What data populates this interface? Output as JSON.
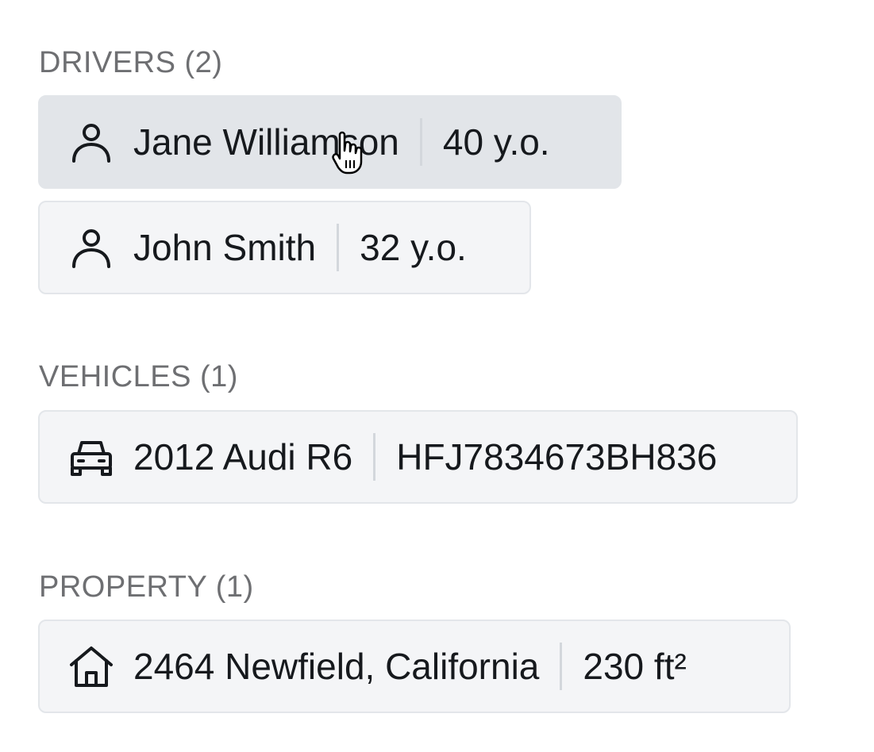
{
  "drivers": {
    "title": "DRIVERS (2)",
    "items": [
      {
        "name": "Jane Williamson",
        "detail": "40 y.o.",
        "icon": "person-icon"
      },
      {
        "name": "John Smith",
        "detail": "32 y.o.",
        "icon": "person-icon"
      }
    ]
  },
  "vehicles": {
    "title": "VEHICLES (1)",
    "items": [
      {
        "name": "2012 Audi R6",
        "detail": "HFJ7834673BH836",
        "icon": "car-icon"
      }
    ]
  },
  "property": {
    "title": "PROPERTY (1)",
    "items": [
      {
        "name": "2464 Newfield, California",
        "detail": "230 ft²",
        "icon": "house-icon"
      }
    ]
  },
  "colors": {
    "section_title": "#6e6f72",
    "chip_background": "#f4f5f7",
    "chip_hover_background": "#e2e5e9",
    "chip_border": "#e3e6ea",
    "divider": "#d3d7dc",
    "text": "#16191d"
  }
}
